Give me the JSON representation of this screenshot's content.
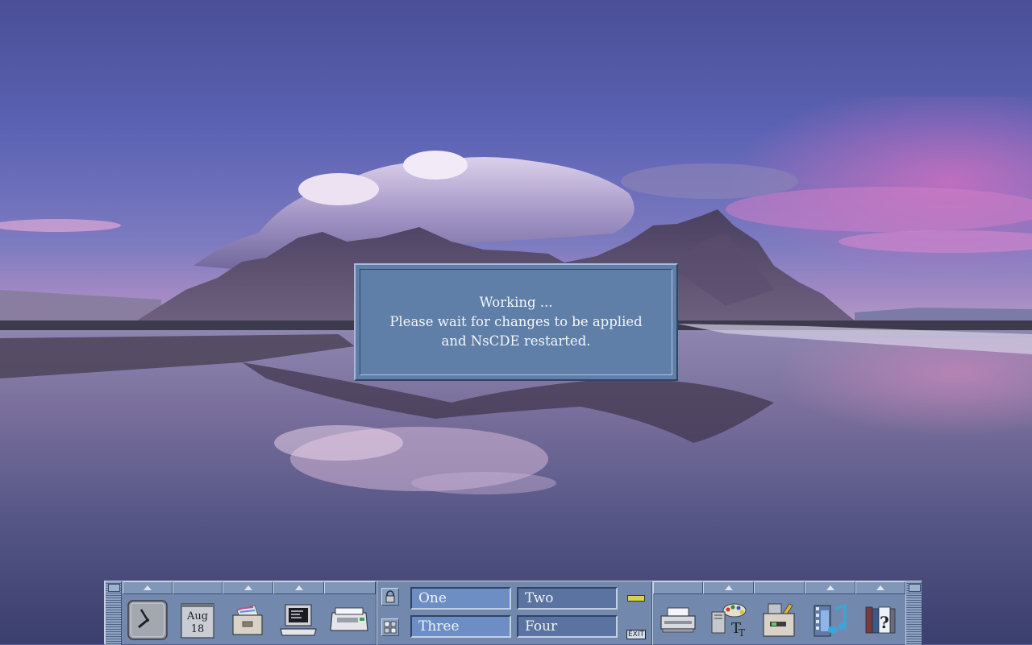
{
  "dialog": {
    "line1": "Working ...",
    "line2": "Please wait for changes to be applied",
    "line3": "and NsCDE restarted."
  },
  "panel": {
    "date": {
      "month": "Aug",
      "day": "18"
    },
    "workspaces": [
      {
        "label": "One",
        "active": true
      },
      {
        "label": "Two",
        "active": false
      },
      {
        "label": "Three",
        "active": true
      },
      {
        "label": "Four",
        "active": false
      }
    ],
    "exit_label": "EXIT",
    "left_launchers": [
      "clock-icon",
      "calendar-icon",
      "file-manager-icon",
      "terminal-icon",
      "mail-icon"
    ],
    "right_launchers": [
      "printer-icon",
      "style-manager-icon",
      "application-manager-icon",
      "media-player-icon",
      "help-icon"
    ]
  },
  "colors": {
    "panel": "#7289ad",
    "dialog": "#5f7ea8",
    "workspace_active": "#6d8ec4",
    "workspace_idle": "#5a73a0"
  }
}
